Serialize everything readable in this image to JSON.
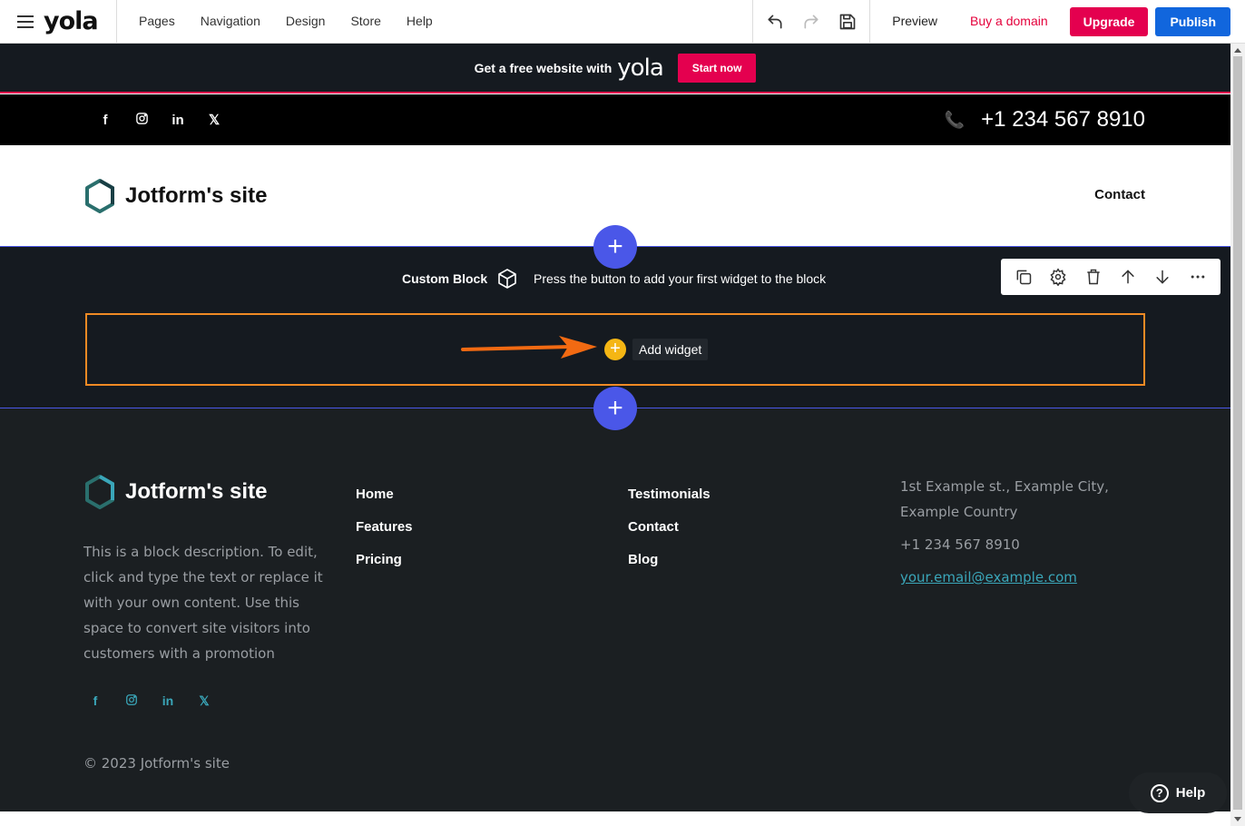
{
  "editor": {
    "logo": "yola",
    "menu": [
      "Pages",
      "Navigation",
      "Design",
      "Store",
      "Help"
    ],
    "preview_label": "Preview",
    "buy_domain_label": "Buy a domain",
    "upgrade_label": "Upgrade",
    "publish_label": "Publish"
  },
  "promo": {
    "text": "Get a free website with",
    "logo": "yola",
    "button_label": "Start now"
  },
  "socialbar": {
    "icons": [
      "facebook-icon",
      "instagram-icon",
      "linkedin-icon",
      "x-icon"
    ],
    "phone": "+1 234 567 8910"
  },
  "header": {
    "site_title": "Jotform's site",
    "nav_contact": "Contact"
  },
  "custom_block": {
    "label": "Custom Block",
    "hint": "Press the button to add your first widget to the block",
    "add_widget_label": "Add widget",
    "tools": [
      "duplicate-icon",
      "settings-icon",
      "delete-icon",
      "move-up-icon",
      "move-down-icon",
      "more-icon"
    ]
  },
  "footer": {
    "site_title": "Jotform's site",
    "description": "This is a block description. To edit, click and type the text or replace it with your own content. Use this space to convert site visitors into customers with a promotion",
    "col1": [
      "Home",
      "Features",
      "Pricing"
    ],
    "col2": [
      "Testimonials",
      "Contact",
      "Blog"
    ],
    "address": "1st Example st., Example City, Example Country",
    "phone": "+1 234 567 8910",
    "email": "your.email@example.com",
    "copyright": "© 2023 Jotform's site"
  },
  "help_label": "Help",
  "colors": {
    "accent_blue": "#4a57e8",
    "brand_pink": "#e4004f",
    "publish_blue": "#1166dd",
    "widget_orange": "#f08a24",
    "footer_bg": "#1b1f22",
    "block_bg": "#151a20"
  }
}
